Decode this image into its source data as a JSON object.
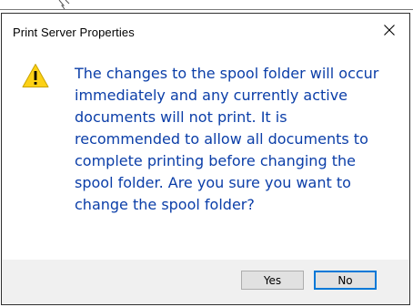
{
  "dialog": {
    "title": "Print Server Properties",
    "close_icon": "close-icon",
    "warning_icon": "warning-icon",
    "message": "The changes to the spool folder will occur\nimmediately and any currently active\ndocuments will not print. It is\nrecommended to allow all documents to\ncomplete printing before changing the\nspool folder. Are you sure you want to\nchange the spool folder?",
    "buttons": {
      "yes_label": "Yes",
      "no_label": "No"
    }
  },
  "colors": {
    "message_text": "#0b3ea8",
    "button_bar": "#f0f0f0",
    "default_button_border": "#0078d7",
    "warning_fill": "#fcd116"
  }
}
